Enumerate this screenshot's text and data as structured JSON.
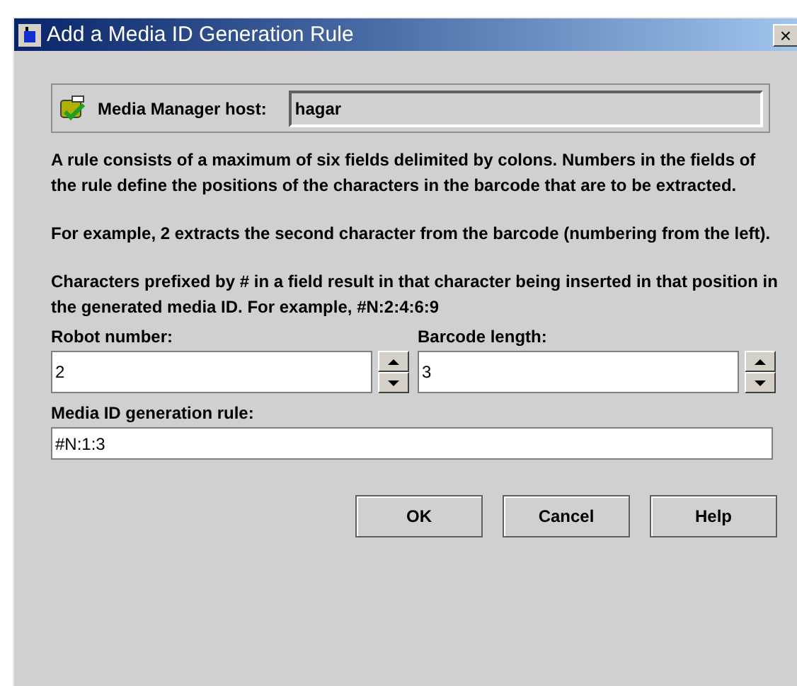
{
  "window": {
    "title": "Add a Media ID Generation Rule",
    "close": "×"
  },
  "host": {
    "label": "Media Manager host:",
    "value": "hagar"
  },
  "paragraphs": [
    "A rule consists of a maximum of six fields delimited by colons. Numbers in the fields of the rule define the positions of the characters in the barcode that are to be extracted.",
    "For example, 2 extracts the second character from the barcode (numbering from the left).",
    "Characters prefixed by # in a field result in that character being inserted in that position in the generated media ID. For example, #N:2:4:6:9"
  ],
  "spinners": [
    {
      "label": "Robot number:",
      "value": "2"
    },
    {
      "label": "Barcode length:",
      "value": "3"
    }
  ],
  "rule": {
    "label": "Media ID generation rule:",
    "value": "#N:1:3"
  },
  "buttons": [
    "OK",
    "Cancel",
    "Help"
  ]
}
